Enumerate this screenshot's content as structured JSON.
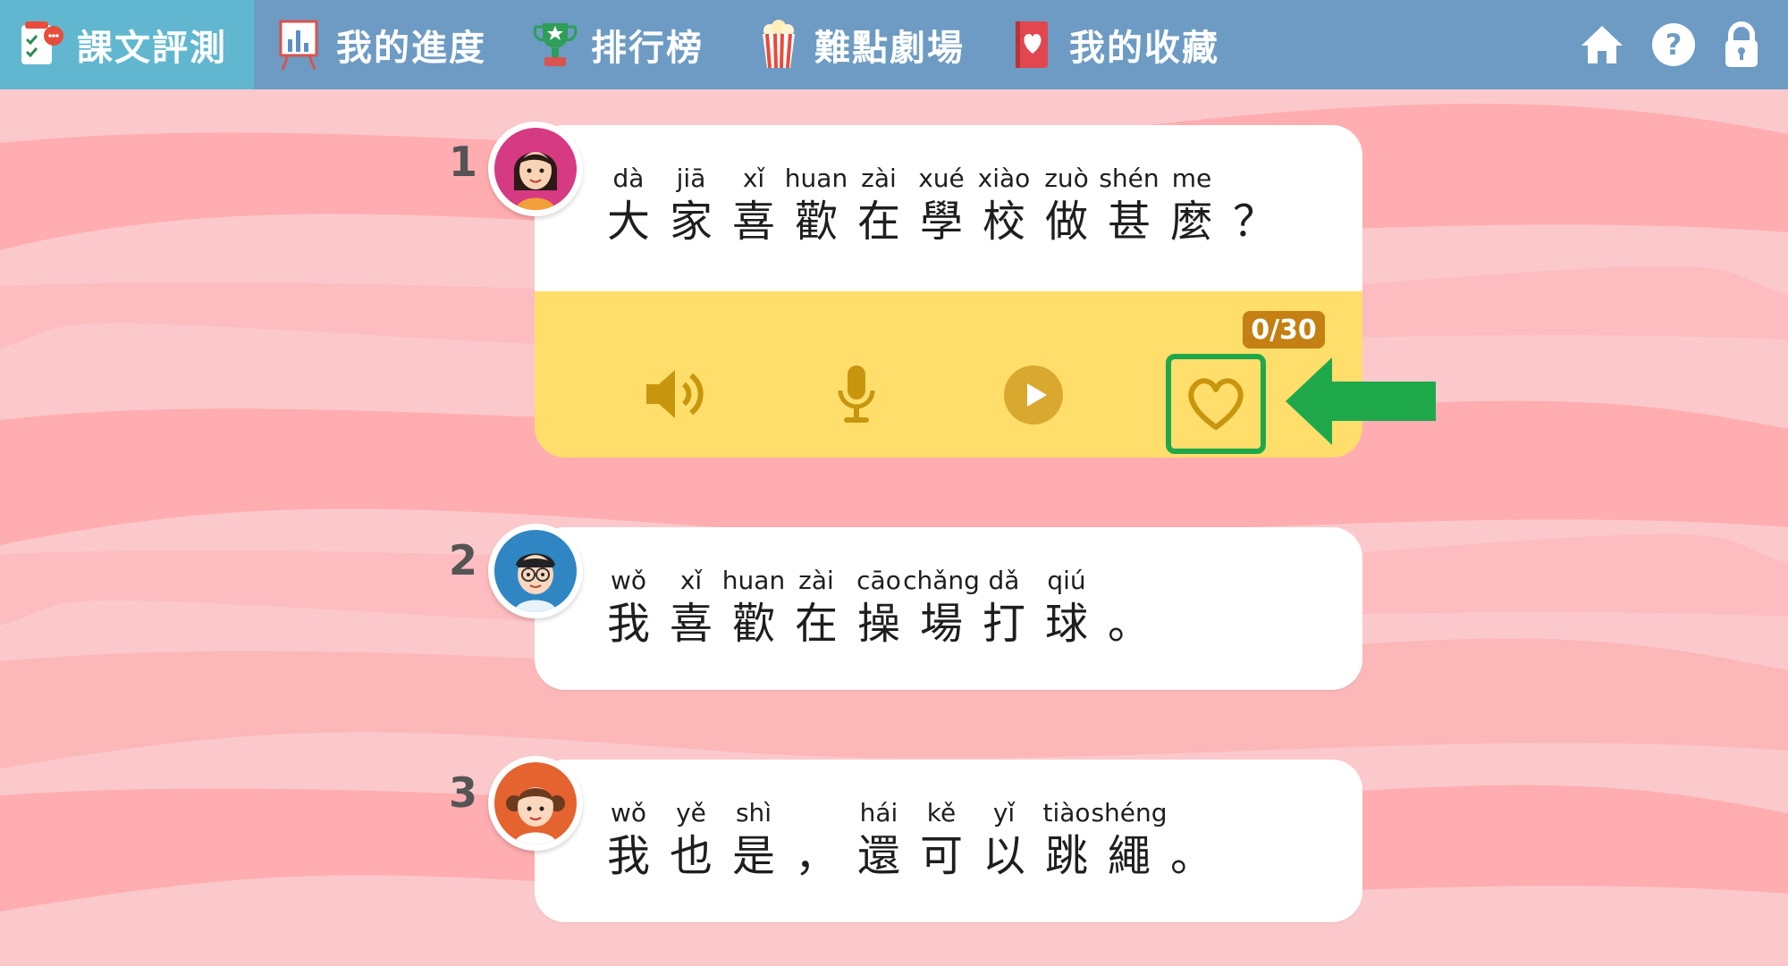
{
  "nav": {
    "items": [
      {
        "label": "課文評測",
        "icon": "checklist-icon",
        "active": true
      },
      {
        "label": "我的進度",
        "icon": "chart-board-icon",
        "active": false
      },
      {
        "label": "排行榜",
        "icon": "trophy-icon",
        "active": false
      },
      {
        "label": "難點劇場",
        "icon": "popcorn-icon",
        "active": false
      },
      {
        "label": "我的收藏",
        "icon": "bookmark-heart-icon",
        "active": false
      }
    ],
    "right_icons": [
      "home-icon",
      "help-icon",
      "lock-icon"
    ]
  },
  "lines": [
    {
      "number": "1",
      "avatar": "girl-teacher-avatar",
      "chars": [
        {
          "py": "dà",
          "hz": "大"
        },
        {
          "py": "jiā",
          "hz": "家"
        },
        {
          "py": "xǐ",
          "hz": "喜"
        },
        {
          "py": "huan",
          "hz": "歡"
        },
        {
          "py": "zài",
          "hz": "在"
        },
        {
          "py": "xué",
          "hz": "學"
        },
        {
          "py": "xiào",
          "hz": "校"
        },
        {
          "py": "zuò",
          "hz": "做"
        },
        {
          "py": "shén",
          "hz": "甚"
        },
        {
          "py": "me",
          "hz": "麼"
        },
        {
          "py": "",
          "hz": "？"
        }
      ]
    },
    {
      "number": "2",
      "avatar": "boy-glasses-avatar",
      "chars": [
        {
          "py": "wǒ",
          "hz": "我"
        },
        {
          "py": "xǐ",
          "hz": "喜"
        },
        {
          "py": "huan",
          "hz": "歡"
        },
        {
          "py": "zài",
          "hz": "在"
        },
        {
          "py": "cāo",
          "hz": "操"
        },
        {
          "py": "chǎng",
          "hz": "場"
        },
        {
          "py": "dǎ",
          "hz": "打"
        },
        {
          "py": "qiú",
          "hz": "球"
        },
        {
          "py": "",
          "hz": "。"
        }
      ]
    },
    {
      "number": "3",
      "avatar": "girl-pigtails-avatar",
      "chars": [
        {
          "py": "wǒ",
          "hz": "我"
        },
        {
          "py": "yě",
          "hz": "也"
        },
        {
          "py": "shì",
          "hz": "是"
        },
        {
          "py": "",
          "hz": "，"
        },
        {
          "py": "hái",
          "hz": "還"
        },
        {
          "py": "kě",
          "hz": "可"
        },
        {
          "py": "yǐ",
          "hz": "以"
        },
        {
          "py": "tiào",
          "hz": "跳"
        },
        {
          "py": "shéng",
          "hz": "繩"
        },
        {
          "py": "",
          "hz": "。"
        }
      ]
    }
  ],
  "controls": {
    "counter": "0/30",
    "buttons": [
      "speaker-icon",
      "microphone-icon",
      "play-icon",
      "heart-icon"
    ]
  },
  "colors": {
    "nav_bg": "#6d9bc3",
    "nav_active": "#61b7cf",
    "controls_bg": "#ffde6b",
    "control_icon": "#c8960e",
    "counter_bg": "#c48012",
    "highlight": "#1ea84a",
    "background": "#fbc9cb"
  }
}
